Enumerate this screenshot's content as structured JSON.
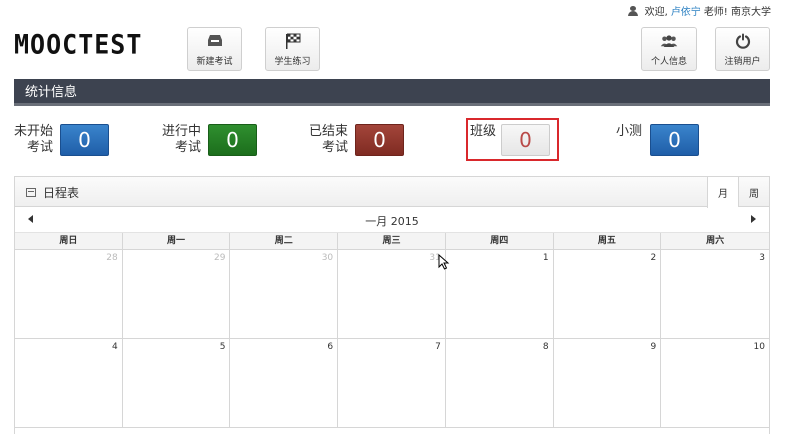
{
  "user_bar": {
    "welcome": "欢迎,",
    "user_name": "卢依宁",
    "suffix": "老师! 南京大学"
  },
  "logo": {
    "text": "MOOCTEST"
  },
  "toolbar": {
    "new_exam": "新建考试",
    "practice": "学生练习",
    "profile": "个人信息",
    "logout": "注销用户"
  },
  "stats": {
    "header": "统计信息",
    "items": [
      {
        "label_line1": "未开始",
        "label_line2": "考试",
        "value": "0",
        "color": "#2b6cb0"
      },
      {
        "label_line1": "进行中",
        "label_line2": "考试",
        "value": "0",
        "color": "#237a23"
      },
      {
        "label_line1": "已结束",
        "label_line2": "考试",
        "value": "0",
        "color": "#8f362d"
      },
      {
        "label_line1": "班级",
        "label_line2": "",
        "value": "0",
        "color": "#efefef"
      },
      {
        "label_line1": "小测",
        "label_line2": "",
        "value": "0",
        "color": "#2b6cb0"
      }
    ]
  },
  "calendar": {
    "title": "日程表",
    "view_month": "月",
    "view_week": "周",
    "month_label": "一月 2015",
    "weekdays": [
      "周日",
      "周一",
      "周二",
      "周三",
      "周四",
      "周五",
      "周六"
    ],
    "days": [
      {
        "n": "28",
        "other": true
      },
      {
        "n": "29",
        "other": true
      },
      {
        "n": "30",
        "other": true
      },
      {
        "n": "31",
        "other": true
      },
      {
        "n": "1",
        "other": false
      },
      {
        "n": "2",
        "other": false
      },
      {
        "n": "3",
        "other": false
      },
      {
        "n": "4",
        "other": false
      },
      {
        "n": "5",
        "other": false
      },
      {
        "n": "6",
        "other": false
      },
      {
        "n": "7",
        "other": false
      },
      {
        "n": "8",
        "other": false
      },
      {
        "n": "9",
        "other": false
      },
      {
        "n": "10",
        "other": false
      }
    ]
  },
  "colors": {
    "accent_blue": "#2b6cb0",
    "header_bar": "#3d4350",
    "highlight_red": "#d9282c"
  }
}
